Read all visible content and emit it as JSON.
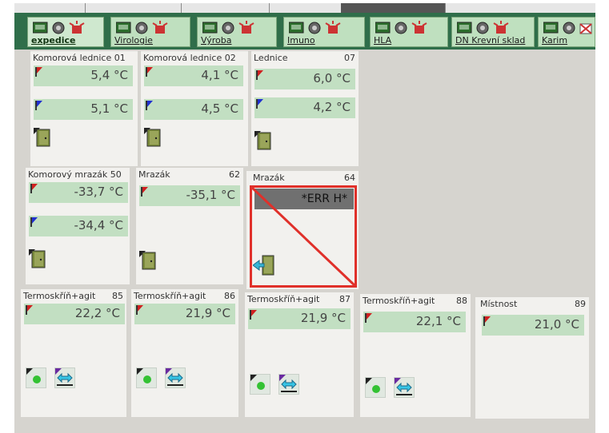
{
  "tabs": [
    {
      "label": "expedice",
      "active": true
    },
    {
      "label": "Virologie"
    },
    {
      "label": "Výroba"
    },
    {
      "label": "Imuno"
    },
    {
      "label": "HLA"
    },
    {
      "label": "DN Krevní sklad"
    },
    {
      "label": "Karim"
    }
  ],
  "panels": [
    {
      "title": "Komorová lednice 01",
      "number": "",
      "t1": "5,4 °C",
      "t2": "5,1 °C"
    },
    {
      "title": "Komorová lednice 02",
      "number": "",
      "t1": "4,1 °C",
      "t2": "4,5 °C"
    },
    {
      "title": "Lednice",
      "number": "07",
      "t1": "6,0 °C",
      "t2": "4,2 °C"
    },
    {
      "title": "Komorový mrazák 50",
      "number": "",
      "t1": "-33,7 °C",
      "t2": "-34,4 °C"
    },
    {
      "title": "Mrazák",
      "number": "62",
      "t1": "-35,1 °C"
    },
    {
      "title": "Mrazák",
      "number": "64",
      "error": "*ERR H*"
    },
    {
      "title": "Termoskříň+agit",
      "number": "85",
      "t1": "22,2 °C"
    },
    {
      "title": "Termoskříň+agit",
      "number": "86",
      "t1": "21,9 °C"
    },
    {
      "title": "Termoskříň+agit",
      "number": "87",
      "t1": "21,9 °C"
    },
    {
      "title": "Termoskříň+agit",
      "number": "88",
      "t1": "22,1 °C"
    },
    {
      "title": "Místnost",
      "number": "89",
      "t1": "21,0 °C"
    }
  ],
  "colors": {
    "tab_bar": "#2f6e4a",
    "temp_bg": "#c2dfc2",
    "panel_bg": "#f2f1ee",
    "error_red": "#e0302a",
    "flag_red": "#d02020",
    "flag_blue": "#2030d0"
  },
  "icons": [
    "monitor-icon",
    "speaker-icon",
    "alarm-siren-icon",
    "alarm-off-icon",
    "door-icon",
    "door-open-arrow-icon",
    "status-led-icon",
    "agitation-arrows-icon"
  ]
}
